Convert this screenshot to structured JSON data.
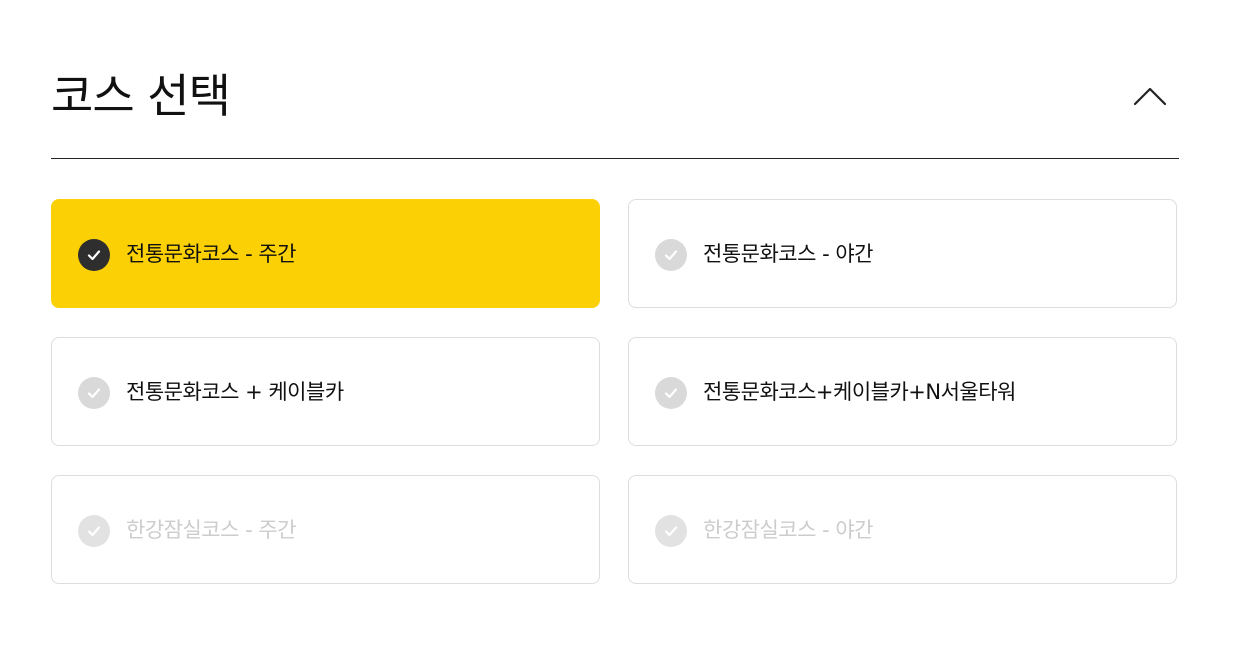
{
  "section": {
    "title": "코스 선택",
    "collapse_icon": "chevron-up-icon"
  },
  "colors": {
    "accent": "#fbd105",
    "check_selected": "#2e2e2e",
    "check_unselected": "#d9d9d9",
    "border": "#dddddd",
    "disabled_text": "#cccccc"
  },
  "options": [
    {
      "label": "전통문화코스 - 주간",
      "state": "selected"
    },
    {
      "label": "전통문화코스 - 야간",
      "state": "default"
    },
    {
      "label": "전통문화코스 + 케이블카",
      "state": "default"
    },
    {
      "label": "전통문화코스+케이블카+N서울타워",
      "state": "default"
    },
    {
      "label": "한강잠실코스 - 주간",
      "state": "disabled"
    },
    {
      "label": "한강잠실코스 - 야간",
      "state": "disabled"
    }
  ]
}
